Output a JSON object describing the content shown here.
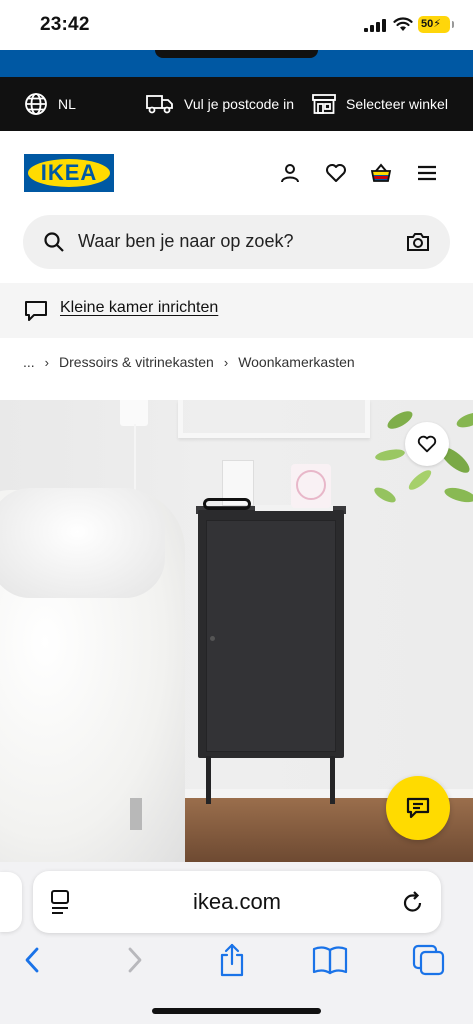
{
  "status_bar": {
    "time": "23:42",
    "battery": "50"
  },
  "utility_bar": {
    "language": "NL",
    "postcode_label": "Vul je postcode in",
    "store_label": "Selecteer winkel"
  },
  "header": {
    "logo_text": "IKEA",
    "brand_blue": "#0058a3",
    "brand_yellow": "#ffdb00"
  },
  "search": {
    "placeholder": "Waar ben je naar op zoek?"
  },
  "inspiration": {
    "link_label": "Kleine kamer inrichten"
  },
  "breadcrumb": {
    "items": [
      "...",
      "Dressoirs & vitrinekasten",
      "Woonkamerkasten"
    ]
  },
  "browser": {
    "url": "ikea.com"
  }
}
